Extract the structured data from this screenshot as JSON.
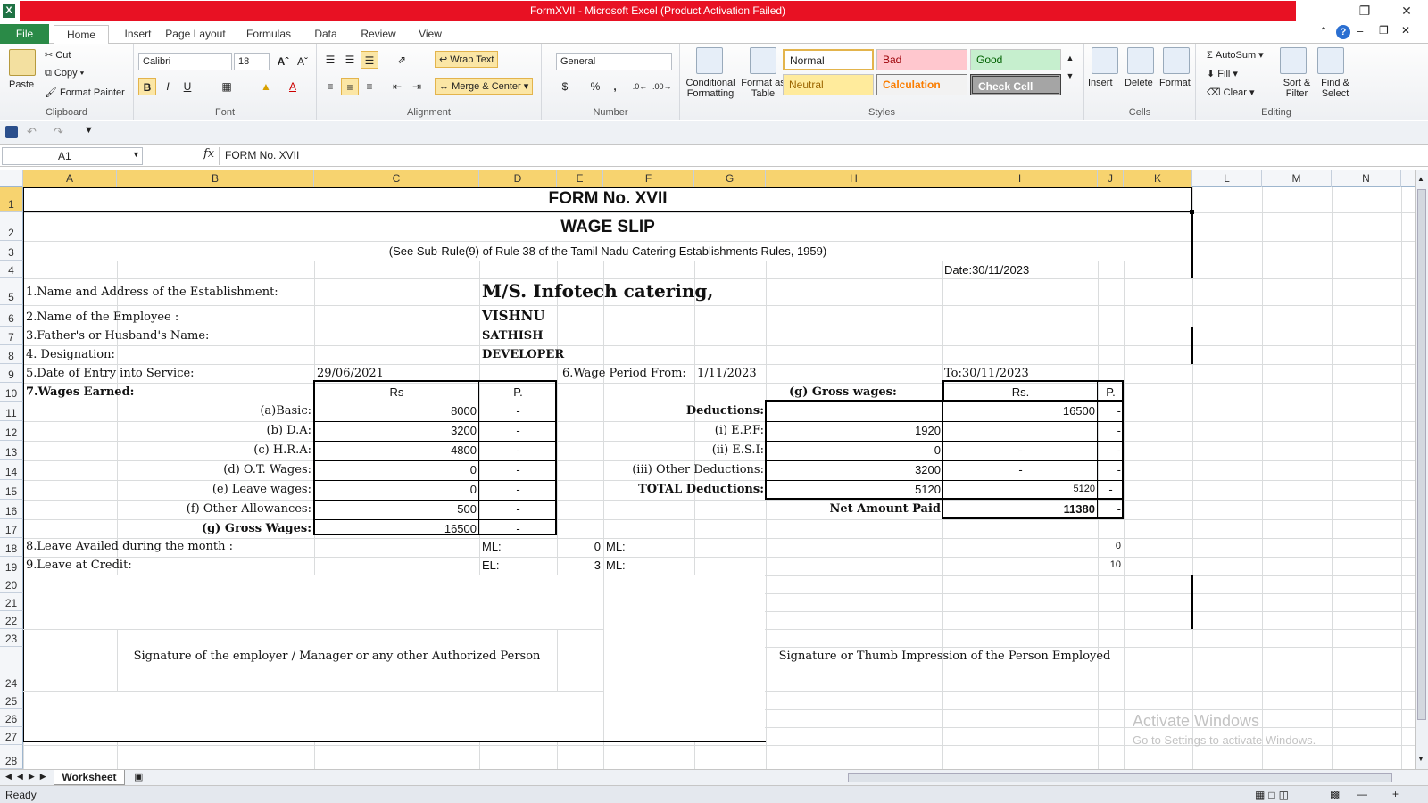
{
  "window": {
    "title": "FormXVII  -  Microsoft Excel (Product Activation Failed)"
  },
  "tabs": [
    "File",
    "Home",
    "Insert",
    "Page Layout",
    "Formulas",
    "Data",
    "Review",
    "View"
  ],
  "ribbon": {
    "clipboard": {
      "paste": "Paste",
      "cut": "Cut",
      "copy": "Copy",
      "format_painter": "Format Painter",
      "label": "Clipboard"
    },
    "font": {
      "name": "Calibri",
      "size": "18",
      "bold": "B",
      "italic": "I",
      "underline": "U",
      "label": "Font"
    },
    "alignment": {
      "wrap": "Wrap Text",
      "merge": "Merge & Center",
      "label": "Alignment"
    },
    "number": {
      "format": "General",
      "currency": "$",
      "percent": "%",
      "comma": ",",
      "label": "Number"
    },
    "styles": {
      "conditional": "Conditional Formatting",
      "format_table": "Format as Table",
      "normal": "Normal",
      "bad": "Bad",
      "good": "Good",
      "neutral": "Neutral",
      "calculation": "Calculation",
      "check": "Check Cell",
      "label": "Styles"
    },
    "cells": {
      "insert": "Insert",
      "delete": "Delete",
      "format": "Format",
      "label": "Cells"
    },
    "editing": {
      "autosum": "AutoSum",
      "fill": "Fill",
      "clear": "Clear",
      "sort": "Sort & Filter",
      "find": "Find & Select",
      "label": "Editing"
    }
  },
  "formula_bar": {
    "name_box": "A1",
    "fx": "fx",
    "content": "FORM No. XVII"
  },
  "columns": [
    "A",
    "B",
    "C",
    "D",
    "E",
    "F",
    "G",
    "H",
    "I",
    "J",
    "K",
    "L",
    "M",
    "N"
  ],
  "rows": [
    "1",
    "2",
    "3",
    "4",
    "5",
    "6",
    "7",
    "8",
    "9",
    "10",
    "11",
    "12",
    "13",
    "14",
    "15",
    "16",
    "17",
    "18",
    "19",
    "20",
    "21",
    "22",
    "23",
    "24",
    "25",
    "26",
    "27",
    "28"
  ],
  "form": {
    "title": "FORM No. XVII",
    "subtitle": "WAGE SLIP",
    "rule": "(See Sub-Rule(9) of Rule 38 of the Tamil Nadu Catering Establishments Rules, 1959)",
    "date": "Date:30/11/2023",
    "est_label": "1.Name and Address of the Establishment:",
    "est_value": "M/S. Infotech catering,",
    "emp_label": "2.Name of the Employee :",
    "emp_value": "VISHNU",
    "father_label": "3.Father's or Husband's Name:",
    "father_value": "SATHISH",
    "desig_label": "4. Designation:",
    "desig_value": "DEVELOPER",
    "entry_label": "5.Date of Entry into Service:",
    "entry_value": "29/06/2021",
    "period_label": "6.Wage Period From:",
    "period_from": "1/11/2023",
    "period_to": "To:30/11/2023",
    "wages_label": "7.Wages Earned:",
    "rs": "Rs",
    "p": "P.",
    "gross_label_right": "(g) Gross wages:",
    "rs_right": "Rs.",
    "p_right": "P.",
    "earn": [
      {
        "label": "(a)Basic:",
        "rs": "8000",
        "p": "-"
      },
      {
        "label": "(b) D.A:",
        "rs": "3200",
        "p": "-"
      },
      {
        "label": "(c) H.R.A:",
        "rs": "4800",
        "p": "-"
      },
      {
        "label": "(d) O.T. Wages:",
        "rs": "0",
        "p": "-"
      },
      {
        "label": "(e) Leave wages:",
        "rs": "0",
        "p": "-"
      },
      {
        "label": "(f) Other Allowances:",
        "rs": "500",
        "p": "-"
      },
      {
        "label": "(g) Gross Wages:",
        "rs": "16500",
        "p": "-"
      }
    ],
    "deductions_label": "Deductions:",
    "gross_value": "16500",
    "ded": [
      {
        "label": "(i) E.P.F:",
        "h": "1920",
        "i": "",
        "j": "-"
      },
      {
        "label": "(ii) E.S.I:",
        "h": "0",
        "i": "-",
        "j": "-"
      },
      {
        "label": "(iii) Other Deductions:",
        "h": "3200",
        "i": "-",
        "j": "-"
      },
      {
        "label": "TOTAL Deductions:",
        "h": "5120",
        "i": "5120",
        "j": "-"
      }
    ],
    "g11_dash": "-",
    "net_label": "Net Amount Paid",
    "net_value": "11380",
    "net_dash": "-",
    "leave_availed_label": "8.Leave Availed during the month :",
    "ml1": "ML:",
    "ml1_val": "0",
    "ml2": "ML:",
    "ml2_val": "0",
    "leave_credit_label": "9.Leave at Credit:",
    "el": "EL:",
    "el_val": "3",
    "ml3": "ML:",
    "ml3_val": "10",
    "sig_employer": "Signature of the employer / Manager or any other Authorized Person",
    "sig_employee": "Signature or Thumb Impression of the Person Employed"
  },
  "sheet_tab": "Worksheet",
  "status": "Ready",
  "watermark": {
    "line1": "Activate Windows",
    "line2": "Go to Settings to activate Windows."
  }
}
